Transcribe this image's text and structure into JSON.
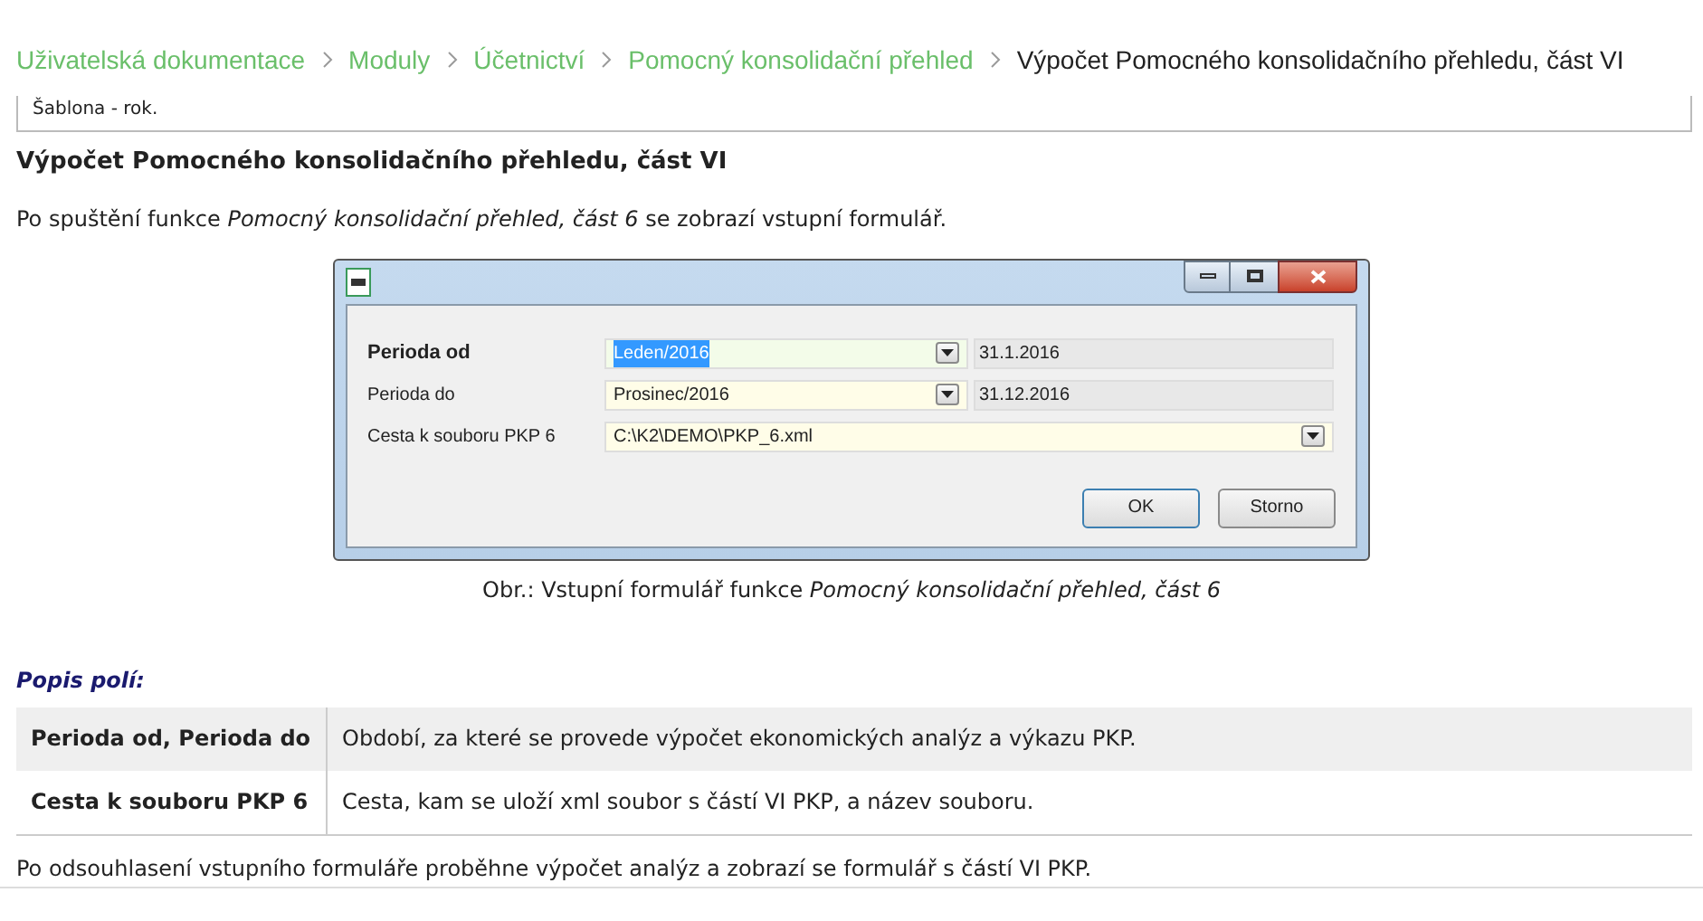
{
  "breadcrumbs": [
    {
      "label": "Uživatelská dokumentace",
      "current": false
    },
    {
      "label": "Moduly",
      "current": false
    },
    {
      "label": "Účetnictví",
      "current": false
    },
    {
      "label": "Pomocný konsolidační přehled",
      "current": false
    },
    {
      "label": "Výpočet Pomocného konsolidačního přehledu, část VI",
      "current": true
    }
  ],
  "clipped_note": "Šablona - rok.",
  "heading": "Výpočet Pomocného konsolidačního přehledu, část VI",
  "intro": "Po spuštění funkce *Pomocný konsolidační přehled, část 6* se zobrazí vstupní formulář.",
  "dialog": {
    "rows": [
      {
        "kind": "period",
        "label": "Perioda od",
        "value": "Leden/2016",
        "date": "31.1.2016",
        "focused": true
      },
      {
        "kind": "period",
        "label": "Perioda do",
        "value": "Prosinec/2016",
        "date": "31.12.2016",
        "focused": false
      },
      {
        "kind": "path",
        "label": "Cesta k souboru PKP 6",
        "value": "C:\\K2\\DEMO\\PKP_6.xml",
        "focused": false
      }
    ],
    "buttons": [
      {
        "label": "OK",
        "default": true
      },
      {
        "label": "Storno",
        "default": false
      }
    ]
  },
  "caption": "Obr.: Vstupní formulář funkce *Pomocný konsolidační přehled, část 6*",
  "fields_heading": "Popis polí:",
  "fields_table": [
    {
      "name": "Perioda od, Perioda do",
      "description": "Období, za které se provede výpočet ekonomických analýz a výkazu PKP."
    },
    {
      "name": "Cesta k souboru PKP 6",
      "description": "Cesta, kam se uloží xml soubor s částí VI PKP, a název souboru."
    }
  ],
  "outro": "Po odsouhlasení vstupního formuláře proběhne výpočet analýz a zobrazí se formulář s částí VI PKP."
}
